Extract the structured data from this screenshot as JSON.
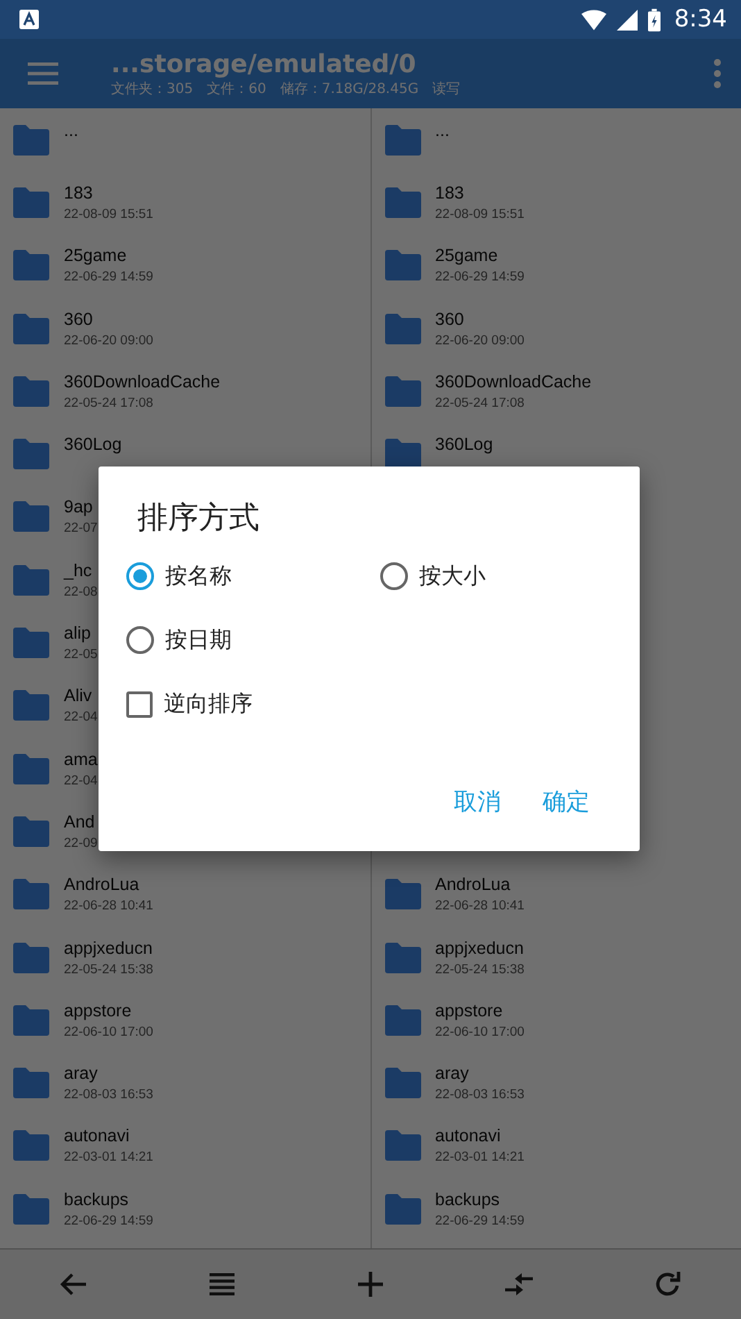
{
  "status_bar": {
    "time": "8:34"
  },
  "toolbar": {
    "title": "...storage/emulated/0",
    "stats": [
      "文件夹：305",
      "文件：60",
      "储存：7.18G/28.45G",
      "读写"
    ]
  },
  "left_pane": {
    "rows": [
      {
        "name": "..."
      },
      {
        "name": "183",
        "date": "22-08-09 15:51"
      },
      {
        "name": "25game",
        "date": "22-06-29 14:59"
      },
      {
        "name": "360",
        "date": "22-06-20 09:00"
      },
      {
        "name": "360DownloadCache",
        "date": "22-05-24 17:08"
      },
      {
        "name": "360Log"
      },
      {
        "name": "9ap",
        "date": "22-07"
      },
      {
        "name": "_hc",
        "date": "22-08"
      },
      {
        "name": "alip",
        "date": "22-05"
      },
      {
        "name": "Aliv",
        "date": "22-04"
      },
      {
        "name": "ama",
        "date": "22-04"
      },
      {
        "name": "And",
        "date": "22-09"
      },
      {
        "name": "AndroLua",
        "date": "22-06-28 10:41"
      },
      {
        "name": "appjxeducn",
        "date": "22-05-24 15:38"
      },
      {
        "name": "appstore",
        "date": "22-06-10 17:00"
      },
      {
        "name": "aray",
        "date": "22-08-03 16:53"
      },
      {
        "name": "autonavi",
        "date": "22-03-01 14:21"
      },
      {
        "name": "backups",
        "date": "22-06-29 14:59"
      }
    ]
  },
  "right_pane": {
    "rows_above": [
      {
        "name": "..."
      },
      {
        "name": "183",
        "date": "22-08-09 15:51"
      },
      {
        "name": "25game",
        "date": "22-06-29 14:59"
      },
      {
        "name": "360",
        "date": "22-06-20 09:00"
      },
      {
        "name": "360DownloadCache",
        "date": "22-05-24 17:08"
      },
      {
        "name": "360Log"
      }
    ],
    "rows_below": [
      {
        "name": "AndroLua",
        "date": "22-06-28 10:41"
      },
      {
        "name": "appjxeducn",
        "date": "22-05-24 15:38"
      },
      {
        "name": "appstore",
        "date": "22-06-10 17:00"
      },
      {
        "name": "aray",
        "date": "22-08-03 16:53"
      },
      {
        "name": "autonavi",
        "date": "22-03-01 14:21"
      },
      {
        "name": "backups",
        "date": "22-06-29 14:59"
      }
    ]
  },
  "dialog": {
    "title": "排序方式",
    "options": [
      {
        "kind": "radio",
        "label": "按名称",
        "selected": true
      },
      {
        "kind": "radio",
        "label": "按大小",
        "selected": false
      },
      {
        "kind": "radio",
        "label": "按日期",
        "selected": false
      },
      {
        "kind": "checkbox",
        "label": "逆向排序",
        "checked": false
      }
    ],
    "buttons": [
      "取消",
      "确定"
    ]
  }
}
